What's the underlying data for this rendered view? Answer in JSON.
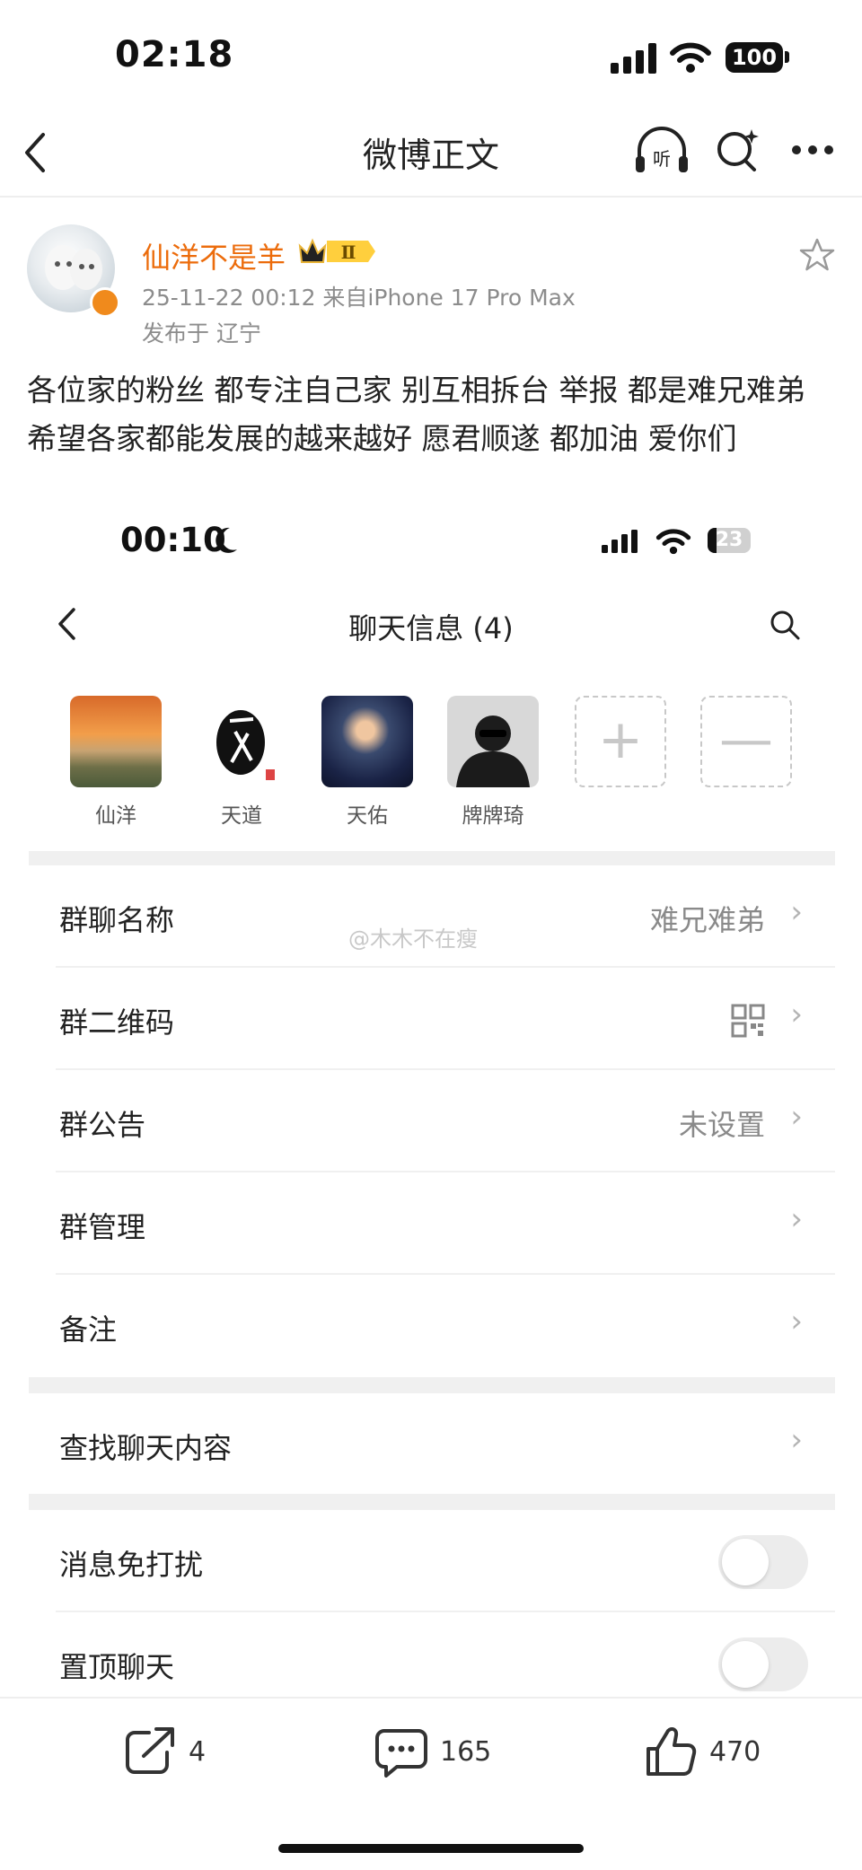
{
  "status_bar": {
    "time": "02:18",
    "battery": "100"
  },
  "nav": {
    "title": "微博正文"
  },
  "post": {
    "username": "仙洋不是羊",
    "badge": "Ⅱ",
    "meta": "25-11-22 00:12  来自iPhone 17 Pro Max",
    "location": "发布于 辽宁",
    "text": "各位家的粉丝 都专注自己家 别互相拆台 举报 都是难兄难弟 希望各家都能发展的越来越好 愿君顺遂 都加油 爱你们"
  },
  "embedded": {
    "status_time": "00:10",
    "battery": "23",
    "title": "聊天信息 (4)",
    "members": [
      {
        "name": "仙洋"
      },
      {
        "name": "天道"
      },
      {
        "name": "天佑"
      },
      {
        "name": "牌牌琦"
      }
    ],
    "rows": {
      "group_name": {
        "label": "群聊名称",
        "value": "难兄难弟"
      },
      "qr": {
        "label": "群二维码"
      },
      "notice": {
        "label": "群公告",
        "value": "未设置"
      },
      "manage": {
        "label": "群管理"
      },
      "remark": {
        "label": "备注"
      },
      "search": {
        "label": "查找聊天内容"
      },
      "mute": {
        "label": "消息免打扰"
      },
      "pin": {
        "label": "置顶聊天"
      }
    },
    "watermark": "@木木不在瘦"
  },
  "actions": {
    "repost": "4",
    "comment": "165",
    "like": "470"
  },
  "colors": {
    "username": "#ec6c0c",
    "band": "#f0f0f0"
  }
}
